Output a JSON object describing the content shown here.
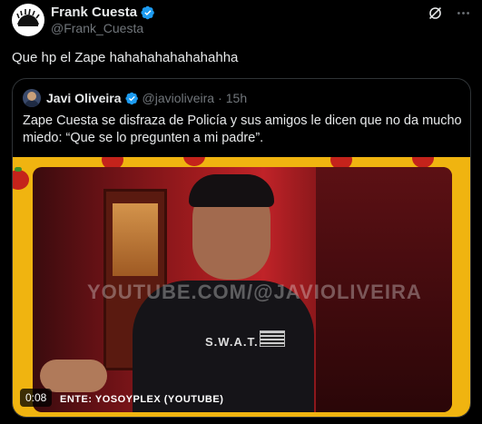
{
  "post": {
    "author": {
      "display_name": "Frank Cuesta",
      "handle": "@Frank_Cuesta",
      "verified": true,
      "avatar_icon": "porcupine-avatar"
    },
    "text": "Que hp el Zape hahahahahahahahha",
    "actions": {
      "grok_icon": "grok-icon",
      "more_icon": "more-icon"
    }
  },
  "quote": {
    "author": {
      "display_name": "Javi Oliveira",
      "handle": "@javioliveira",
      "separator": "·",
      "time": "15h",
      "verified": true
    },
    "text": "Zape Cuesta se disfraza de Policía y sus amigos le dicen que no da mucho miedo: “Que se lo pregunten a mi padre”.",
    "media": {
      "type": "video",
      "timestamp": "0:08",
      "overlay_watermark": "YOUTUBE.COM/@JAVIOLIVEIRA",
      "overlay_credit": "ENTE: YOSOYPLEX (YOUTUBE)",
      "vest_label": "S.W.A.T."
    }
  },
  "colors": {
    "background": "#000000",
    "text_primary": "#e7e9ea",
    "text_secondary": "#71767b",
    "verified_blue": "#1d9bf0",
    "border": "#2f3336",
    "media_frame_yellow": "#f0b410"
  }
}
